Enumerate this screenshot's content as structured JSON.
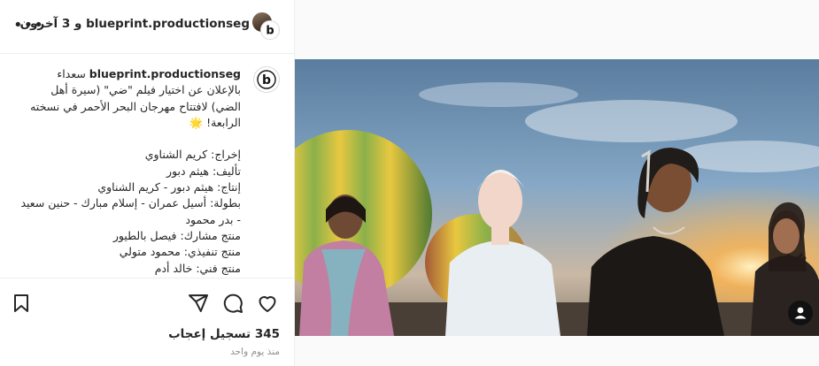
{
  "header": {
    "title": "blueprint.productionseg و 3 آخرون",
    "more_icon": "more-horizontal-icon",
    "avatar_icon": "profile-photo-stack"
  },
  "caption": {
    "username": "blueprint.productionseg",
    "text": " سعداء بالإعلان عن اختيار فيلم \"ضي\" (سيرة أهل الضي) لافتتاح مهرجان البحر الأحمر في نسخته الرابعة! 🌟\n\nإخراج: كريم الشناوي\nتأليف: هيثم دبور\nإنتاج: هيثم دبور - كريم الشناوي\nبطولة: أسيل عمران - إسلام مبارك - حنين سعيد - بدر محمود\nمنتج مشارك: فيصل بالطيور\nمنتج تنفيذي: محمود متولي\nمنتج فني: خالد أدم\nمدير تصوير: عبد السلام موسى"
  },
  "actions": {
    "like_icon": "heart-icon",
    "comment_icon": "comment-icon",
    "share_icon": "paper-plane-icon",
    "save_icon": "bookmark-icon"
  },
  "stats": {
    "likes": "345 تسجيل إعجاب",
    "time": "منذ يوم واحد"
  },
  "media": {
    "description_icon": "user-tag-icon",
    "colors": {
      "sky": "#7fa3c4",
      "sun": "#ffb347",
      "balloon_green": "#8bb04a",
      "balloon_yellow": "#e8c840"
    }
  }
}
